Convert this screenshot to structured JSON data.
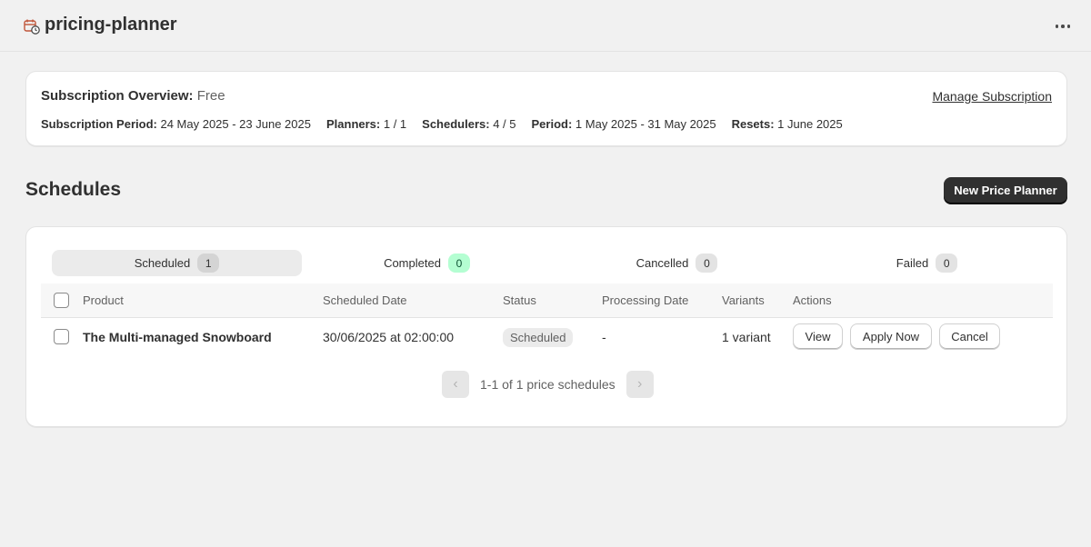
{
  "app": {
    "title": "pricing-planner",
    "icon": "calendar-clock-icon",
    "menu_icon": "more-horizontal-icon"
  },
  "subscription": {
    "title_label": "Subscription Overview:",
    "plan": "Free",
    "manage_link": "Manage Subscription",
    "stats": [
      {
        "label": "Subscription Period:",
        "value": "24 May 2025 - 23 June 2025"
      },
      {
        "label": "Planners:",
        "value": "1 / 1"
      },
      {
        "label": "Schedulers:",
        "value": "4 / 5"
      },
      {
        "label": "Period:",
        "value": "1 May 2025 - 31 May 2025"
      },
      {
        "label": "Resets:",
        "value": "1 June 2025"
      }
    ]
  },
  "schedules": {
    "title": "Schedules",
    "new_button": "New Price Planner",
    "tabs": [
      {
        "label": "Scheduled",
        "count": "1",
        "active": true
      },
      {
        "label": "Completed",
        "count": "0",
        "active": false
      },
      {
        "label": "Cancelled",
        "count": "0",
        "active": false
      },
      {
        "label": "Failed",
        "count": "0",
        "active": false
      }
    ],
    "columns": [
      "Product",
      "Scheduled Date",
      "Status",
      "Processing Date",
      "Variants",
      "Actions"
    ],
    "rows": [
      {
        "product": "The Multi-managed Snowboard",
        "scheduled_date": "30/06/2025 at 02:00:00",
        "status": "Scheduled",
        "processing_date": "-",
        "variants": "1 variant",
        "actions": [
          "View",
          "Apply Now",
          "Cancel"
        ]
      }
    ],
    "pagination": {
      "text": "1-1 of 1 price schedules",
      "prev_icon": "chevron-left-icon",
      "next_icon": "chevron-right-icon"
    }
  },
  "colors": {
    "background": "#f1f1f1",
    "primary_button": "#303030",
    "success_badge": "#b4fed2"
  }
}
